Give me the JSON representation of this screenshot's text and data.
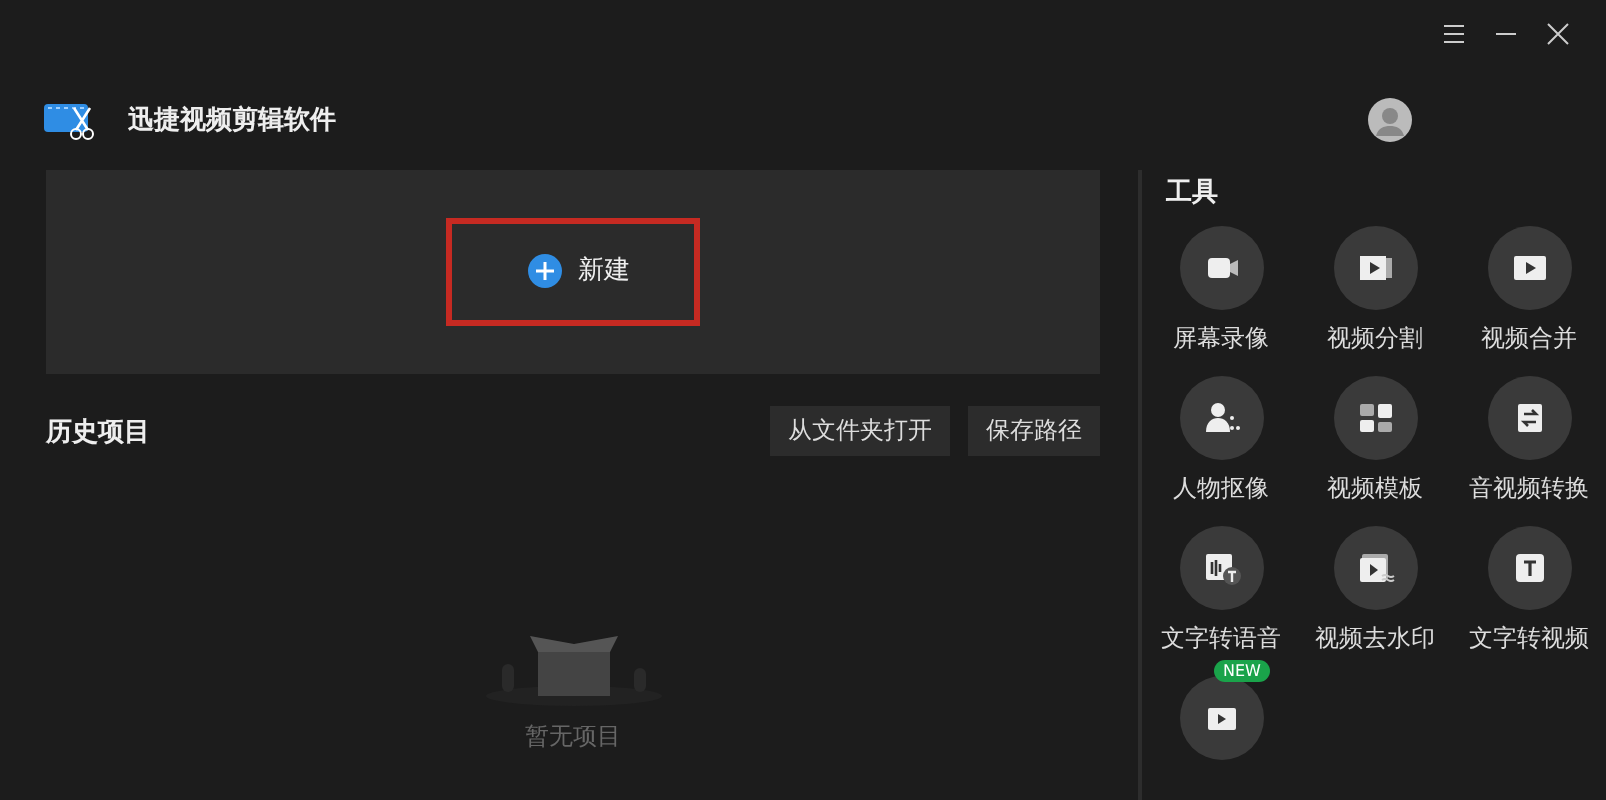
{
  "window": {
    "title": "迅捷视频剪辑软件"
  },
  "new_project": {
    "label": "新建",
    "highlighted": true
  },
  "history": {
    "title": "历史项目",
    "buttons": [
      "从文件夹打开",
      "保存路径"
    ],
    "empty_text": "暂无项目"
  },
  "tools": {
    "title": "工具",
    "items": [
      {
        "label": "屏幕录像"
      },
      {
        "label": "视频分割"
      },
      {
        "label": "视频合并"
      },
      {
        "label": "人物抠像"
      },
      {
        "label": "视频模板"
      },
      {
        "label": "音视频转换"
      },
      {
        "label": "文字转语音"
      },
      {
        "label": "视频去水印"
      },
      {
        "label": "文字转视频"
      },
      {
        "badge": "NEW"
      }
    ]
  }
}
